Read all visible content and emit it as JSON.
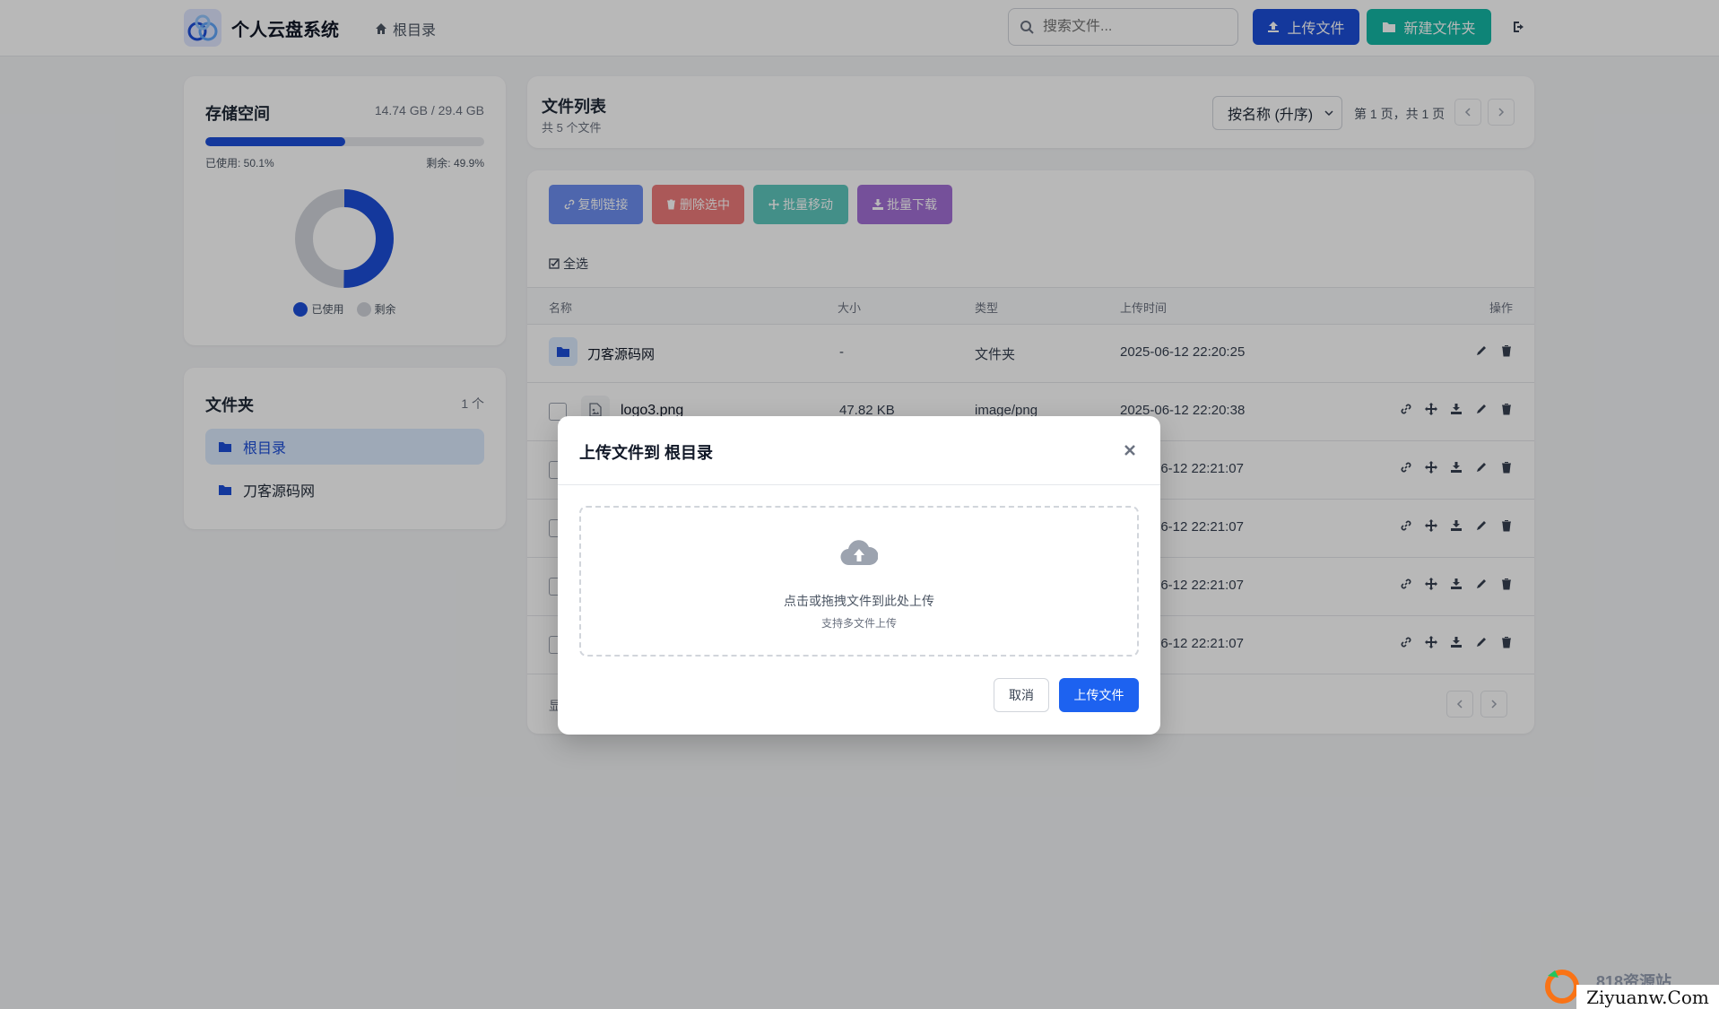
{
  "header": {
    "app_title": "个人云盘系统",
    "breadcrumb": "根目录",
    "search_placeholder": "搜索文件...",
    "upload_label": "上传文件",
    "new_folder_label": "新建文件夹"
  },
  "storage": {
    "title": "存储空间",
    "amount": "14.74 GB / 29.4 GB",
    "used_fraction": 0.501,
    "used_label": "已使用: 50.1%",
    "free_label": "剩余: 49.9%",
    "legend_used": "已使用",
    "legend_free": "剩余",
    "used_color": "#1d4ed8",
    "free_color": "#d1d5db"
  },
  "folders": {
    "title": "文件夹",
    "count": "1 个",
    "items": [
      {
        "label": "根目录"
      },
      {
        "label": "刀客源码网"
      }
    ]
  },
  "file_list": {
    "title": "文件列表",
    "subtitle": "共 5 个文件",
    "sort_value": "按名称 (升序)",
    "page_info": "第 1 页，共 1 页",
    "actions": {
      "copy_link": "复制链接",
      "delete_selected": "删除选中",
      "batch_move": "批量移动",
      "batch_download": "批量下载"
    },
    "select_all": "全选",
    "columns": {
      "name": "名称",
      "size": "大小",
      "type": "类型",
      "upload_time": "上传时间",
      "actions": "操作"
    },
    "rows": [
      {
        "name": "刀客源码网",
        "size": "-",
        "type": "文件夹",
        "time": "2025-06-12 22:20:25"
      },
      {
        "name": "logo3.png",
        "size": "47.82 KB",
        "type": "image/png",
        "time": "2025-06-12 22:20:38"
      },
      {
        "time": "06-12 22:21:07"
      },
      {
        "time": "06-12 22:21:07"
      },
      {
        "time": "06-12 22:21:07"
      },
      {
        "time": "06-12 22:21:07"
      }
    ],
    "footer_text": "显"
  },
  "modal": {
    "title": "上传文件到 根目录",
    "dropzone_main": "点击或拖拽文件到此处上传",
    "dropzone_sub": "支持多文件上传",
    "cancel_label": "取消",
    "confirm_label": "上传文件"
  },
  "watermark": {
    "line1": "818资源站",
    "line2": "Ziyuanw.Com"
  }
}
